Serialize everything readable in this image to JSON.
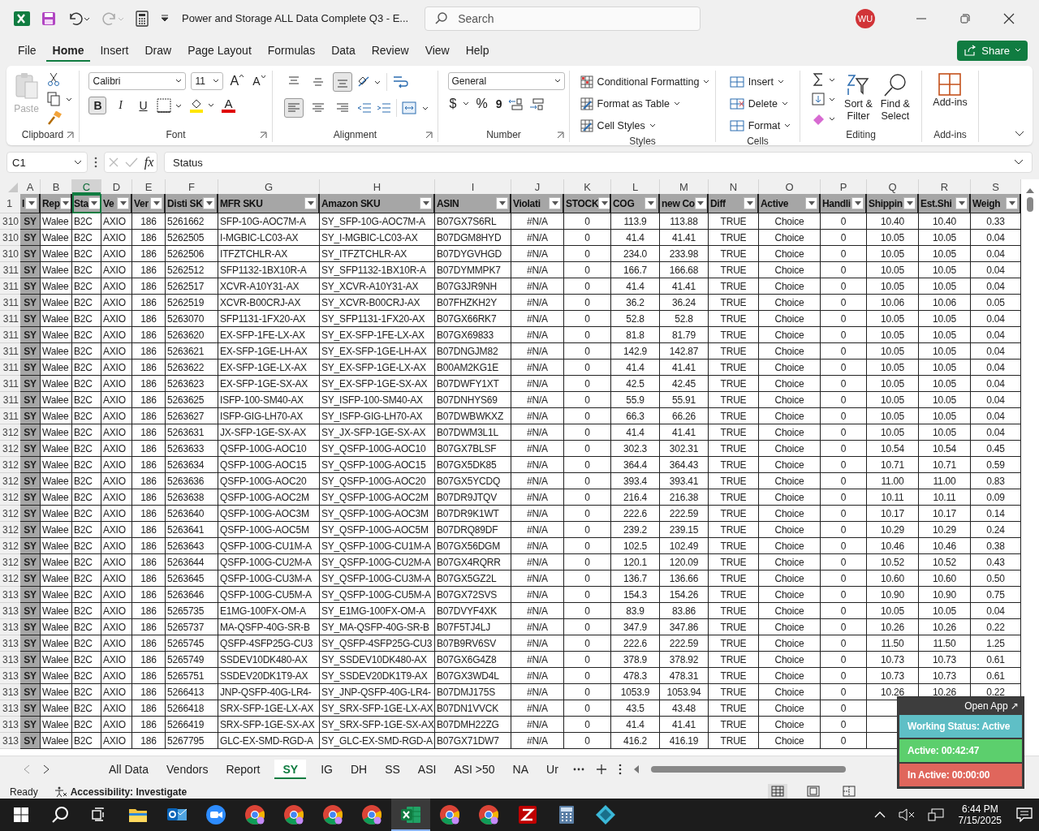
{
  "title_bar": {
    "title": "Power and Storage ALL Data Complete Q3  -  E...",
    "search_placeholder": "Search",
    "avatar": "WU"
  },
  "menu_tabs": [
    {
      "label": "File",
      "selected": false
    },
    {
      "label": "Home",
      "selected": true
    },
    {
      "label": "Insert",
      "selected": false
    },
    {
      "label": "Draw",
      "selected": false
    },
    {
      "label": "Page Layout",
      "selected": false
    },
    {
      "label": "Formulas",
      "selected": false
    },
    {
      "label": "Data",
      "selected": false
    },
    {
      "label": "Review",
      "selected": false
    },
    {
      "label": "View",
      "selected": false
    },
    {
      "label": "Help",
      "selected": false
    }
  ],
  "share": "Share",
  "ribbon": {
    "clipboard": {
      "paste": "Paste",
      "paste_disabled": true,
      "label": "Clipboard"
    },
    "font": {
      "family": "Calibri",
      "size": "11",
      "grow": "A",
      "shrink": "A",
      "bold": "B",
      "bold_on": true,
      "italic": "I",
      "underline": "U",
      "color_glyph": "A",
      "label": "Font"
    },
    "alignment": {
      "vertical": [
        {
          "kind": "top",
          "selected": false
        },
        {
          "kind": "middle",
          "selected": false
        },
        {
          "kind": "bottom",
          "selected": true
        }
      ],
      "horizontal": [
        {
          "kind": "left",
          "selected": true
        },
        {
          "kind": "center",
          "selected": false
        },
        {
          "kind": "right",
          "selected": false
        }
      ],
      "label": "Alignment"
    },
    "number": {
      "format": "General",
      "currency": "$",
      "percent": "%",
      "comma": "9",
      "label": "Number"
    },
    "styles": {
      "items": [
        "Conditional Formatting",
        "Format as Table",
        "Cell Styles"
      ],
      "label": "Styles"
    },
    "cells": {
      "items": [
        "Insert",
        "Delete",
        "Format"
      ],
      "label": "Cells"
    },
    "editing": {
      "sort": [
        "Sort &",
        "Filter"
      ],
      "find": [
        "Find &",
        "Select"
      ],
      "label": "Editing"
    },
    "addins": {
      "button": "Add-ins",
      "label": "Add-ins"
    }
  },
  "formula_bar": {
    "name_box": "C1",
    "fx": "fx",
    "value": "Status"
  },
  "sheet": {
    "header_row": "1",
    "columns": [
      {
        "letter": "A",
        "header": "I",
        "selected": false
      },
      {
        "letter": "B",
        "header": "Rep",
        "selected": false
      },
      {
        "letter": "C",
        "header": "Sta",
        "selected": true
      },
      {
        "letter": "D",
        "header": "Ve",
        "selected": false
      },
      {
        "letter": "E",
        "header": "Ver",
        "selected": false
      },
      {
        "letter": "F",
        "header": "Disti SK",
        "selected": false
      },
      {
        "letter": "G",
        "header": "MFR SKU",
        "selected": false
      },
      {
        "letter": "H",
        "header": "Amazon SKU",
        "selected": false
      },
      {
        "letter": "I",
        "header": "ASIN",
        "selected": false
      },
      {
        "letter": "J",
        "header": "Violati",
        "selected": false
      },
      {
        "letter": "K",
        "header": "STOCK",
        "selected": false
      },
      {
        "letter": "L",
        "header": "COG",
        "selected": false
      },
      {
        "letter": "M",
        "header": "new Co",
        "selected": false
      },
      {
        "letter": "N",
        "header": "Diff",
        "selected": false
      },
      {
        "letter": "O",
        "header": "Active",
        "selected": false
      },
      {
        "letter": "P",
        "header": "Handli",
        "selected": false
      },
      {
        "letter": "Q",
        "header": "Shippin",
        "selected": false
      },
      {
        "letter": "R",
        "header": "Est.Shi",
        "selected": false
      },
      {
        "letter": "S",
        "header": "Weigh",
        "selected": false
      }
    ],
    "rows": [
      {
        "num": "310",
        "cells": [
          "SY",
          "Walee",
          "B2C",
          "AXIO",
          "186",
          "5261662",
          "SFP-10G-AOC7M-A",
          "SY_SFP-10G-AOC7M-A",
          "B07GX7S6RL",
          "#N/A",
          "0",
          "113.9",
          "113.88",
          "TRUE",
          "Choice",
          "0",
          "10.40",
          "10.40",
          "0.33"
        ]
      },
      {
        "num": "310",
        "cells": [
          "SY",
          "Walee",
          "B2C",
          "AXIO",
          "186",
          "5262505",
          "I-MGBIC-LC03-AX",
          "SY_I-MGBIC-LC03-AX",
          "B07DGM8HYD",
          "#N/A",
          "0",
          "41.4",
          "41.41",
          "TRUE",
          "Choice",
          "0",
          "10.05",
          "10.05",
          "0.04"
        ]
      },
      {
        "num": "310",
        "cells": [
          "SY",
          "Walee",
          "B2C",
          "AXIO",
          "186",
          "5262506",
          "ITFZTCHLR-AX",
          "SY_ITFZTCHLR-AX",
          "B07DYGVHGD",
          "#N/A",
          "0",
          "234.0",
          "233.98",
          "TRUE",
          "Choice",
          "0",
          "10.05",
          "10.05",
          "0.04"
        ]
      },
      {
        "num": "311",
        "cells": [
          "SY",
          "Walee",
          "B2C",
          "AXIO",
          "186",
          "5262512",
          "SFP1132-1BX10R-A",
          "SY_SFP1132-1BX10R-A",
          "B07DYMMPK7",
          "#N/A",
          "0",
          "166.7",
          "166.68",
          "TRUE",
          "Choice",
          "0",
          "10.05",
          "10.05",
          "0.04"
        ]
      },
      {
        "num": "311",
        "cells": [
          "SY",
          "Walee",
          "B2C",
          "AXIO",
          "186",
          "5262517",
          "XCVR-A10Y31-AX",
          "SY_XCVR-A10Y31-AX",
          "B07G3JR9NH",
          "#N/A",
          "0",
          "41.4",
          "41.41",
          "TRUE",
          "Choice",
          "0",
          "10.05",
          "10.05",
          "0.04"
        ]
      },
      {
        "num": "311",
        "cells": [
          "SY",
          "Walee",
          "B2C",
          "AXIO",
          "186",
          "5262519",
          "XCVR-B00CRJ-AX",
          "SY_XCVR-B00CRJ-AX",
          "B07FHZKH2Y",
          "#N/A",
          "0",
          "36.2",
          "36.24",
          "TRUE",
          "Choice",
          "0",
          "10.06",
          "10.06",
          "0.05"
        ]
      },
      {
        "num": "311",
        "cells": [
          "SY",
          "Walee",
          "B2C",
          "AXIO",
          "186",
          "5263070",
          "SFP1131-1FX20-AX",
          "SY_SFP1131-1FX20-AX",
          "B07GX66RK7",
          "#N/A",
          "0",
          "52.8",
          "52.8",
          "TRUE",
          "Choice",
          "0",
          "10.05",
          "10.05",
          "0.04"
        ]
      },
      {
        "num": "311",
        "cells": [
          "SY",
          "Walee",
          "B2C",
          "AXIO",
          "186",
          "5263620",
          "EX-SFP-1FE-LX-AX",
          "SY_EX-SFP-1FE-LX-AX",
          "B07GX69833",
          "#N/A",
          "0",
          "81.8",
          "81.79",
          "TRUE",
          "Choice",
          "0",
          "10.05",
          "10.05",
          "0.04"
        ]
      },
      {
        "num": "311",
        "cells": [
          "SY",
          "Walee",
          "B2C",
          "AXIO",
          "186",
          "5263621",
          "EX-SFP-1GE-LH-AX",
          "SY_EX-SFP-1GE-LH-AX",
          "B07DNGJM82",
          "#N/A",
          "0",
          "142.9",
          "142.87",
          "TRUE",
          "Choice",
          "0",
          "10.05",
          "10.05",
          "0.04"
        ]
      },
      {
        "num": "311",
        "cells": [
          "SY",
          "Walee",
          "B2C",
          "AXIO",
          "186",
          "5263622",
          "EX-SFP-1GE-LX-AX",
          "SY_EX-SFP-1GE-LX-AX",
          "B00AM2KG1E",
          "#N/A",
          "0",
          "41.4",
          "41.41",
          "TRUE",
          "Choice",
          "0",
          "10.05",
          "10.05",
          "0.04"
        ]
      },
      {
        "num": "311",
        "cells": [
          "SY",
          "Walee",
          "B2C",
          "AXIO",
          "186",
          "5263623",
          "EX-SFP-1GE-SX-AX",
          "SY_EX-SFP-1GE-SX-AX",
          "B07DWFY1XT",
          "#N/A",
          "0",
          "42.5",
          "42.45",
          "TRUE",
          "Choice",
          "0",
          "10.05",
          "10.05",
          "0.04"
        ]
      },
      {
        "num": "311",
        "cells": [
          "SY",
          "Walee",
          "B2C",
          "AXIO",
          "186",
          "5263625",
          "ISFP-100-SM40-AX",
          "SY_ISFP-100-SM40-AX",
          "B07DNHYS69",
          "#N/A",
          "0",
          "55.9",
          "55.91",
          "TRUE",
          "Choice",
          "0",
          "10.05",
          "10.05",
          "0.04"
        ]
      },
      {
        "num": "311",
        "cells": [
          "SY",
          "Walee",
          "B2C",
          "AXIO",
          "186",
          "5263627",
          "ISFP-GIG-LH70-AX",
          "SY_ISFP-GIG-LH70-AX",
          "B07DWBWKXZ",
          "#N/A",
          "0",
          "66.3",
          "66.26",
          "TRUE",
          "Choice",
          "0",
          "10.05",
          "10.05",
          "0.04"
        ]
      },
      {
        "num": "312",
        "cells": [
          "SY",
          "Walee",
          "B2C",
          "AXIO",
          "186",
          "5263631",
          "JX-SFP-1GE-SX-AX",
          "SY_JX-SFP-1GE-SX-AX",
          "B07DWM3L1L",
          "#N/A",
          "0",
          "41.4",
          "41.41",
          "TRUE",
          "Choice",
          "0",
          "10.05",
          "10.05",
          "0.04"
        ]
      },
      {
        "num": "312",
        "cells": [
          "SY",
          "Walee",
          "B2C",
          "AXIO",
          "186",
          "5263633",
          "QSFP-100G-AOC10",
          "SY_QSFP-100G-AOC10",
          "B07GX7BLSF",
          "#N/A",
          "0",
          "302.3",
          "302.31",
          "TRUE",
          "Choice",
          "0",
          "10.54",
          "10.54",
          "0.45"
        ]
      },
      {
        "num": "312",
        "cells": [
          "SY",
          "Walee",
          "B2C",
          "AXIO",
          "186",
          "5263634",
          "QSFP-100G-AOC15",
          "SY_QSFP-100G-AOC15",
          "B07GX5DK85",
          "#N/A",
          "0",
          "364.4",
          "364.43",
          "TRUE",
          "Choice",
          "0",
          "10.71",
          "10.71",
          "0.59"
        ]
      },
      {
        "num": "312",
        "cells": [
          "SY",
          "Walee",
          "B2C",
          "AXIO",
          "186",
          "5263636",
          "QSFP-100G-AOC20",
          "SY_QSFP-100G-AOC20",
          "B07GX5YCDQ",
          "#N/A",
          "0",
          "393.4",
          "393.41",
          "TRUE",
          "Choice",
          "0",
          "11.00",
          "11.00",
          "0.83"
        ]
      },
      {
        "num": "312",
        "cells": [
          "SY",
          "Walee",
          "B2C",
          "AXIO",
          "186",
          "5263638",
          "QSFP-100G-AOC2M",
          "SY_QSFP-100G-AOC2M",
          "B07DR9JTQV",
          "#N/A",
          "0",
          "216.4",
          "216.38",
          "TRUE",
          "Choice",
          "0",
          "10.11",
          "10.11",
          "0.09"
        ]
      },
      {
        "num": "312",
        "cells": [
          "SY",
          "Walee",
          "B2C",
          "AXIO",
          "186",
          "5263640",
          "QSFP-100G-AOC3M",
          "SY_QSFP-100G-AOC3M",
          "B07DR9K1WT",
          "#N/A",
          "0",
          "222.6",
          "222.59",
          "TRUE",
          "Choice",
          "0",
          "10.17",
          "10.17",
          "0.14"
        ]
      },
      {
        "num": "312",
        "cells": [
          "SY",
          "Walee",
          "B2C",
          "AXIO",
          "186",
          "5263641",
          "QSFP-100G-AOC5M",
          "SY_QSFP-100G-AOC5M",
          "B07DRQ89DF",
          "#N/A",
          "0",
          "239.2",
          "239.15",
          "TRUE",
          "Choice",
          "0",
          "10.29",
          "10.29",
          "0.24"
        ]
      },
      {
        "num": "312",
        "cells": [
          "SY",
          "Walee",
          "B2C",
          "AXIO",
          "186",
          "5263643",
          "QSFP-100G-CU1M-A",
          "SY_QSFP-100G-CU1M-A",
          "B07GX56DGM",
          "#N/A",
          "0",
          "102.5",
          "102.49",
          "TRUE",
          "Choice",
          "0",
          "10.46",
          "10.46",
          "0.38"
        ]
      },
      {
        "num": "312",
        "cells": [
          "SY",
          "Walee",
          "B2C",
          "AXIO",
          "186",
          "5263644",
          "QSFP-100G-CU2M-A",
          "SY_QSFP-100G-CU2M-A",
          "B07GX4RQRR",
          "#N/A",
          "0",
          "120.1",
          "120.09",
          "TRUE",
          "Choice",
          "0",
          "10.52",
          "10.52",
          "0.43"
        ]
      },
      {
        "num": "312",
        "cells": [
          "SY",
          "Walee",
          "B2C",
          "AXIO",
          "186",
          "5263645",
          "QSFP-100G-CU3M-A",
          "SY_QSFP-100G-CU3M-A",
          "B07GX5GZ2L",
          "#N/A",
          "0",
          "136.7",
          "136.66",
          "TRUE",
          "Choice",
          "0",
          "10.60",
          "10.60",
          "0.50"
        ]
      },
      {
        "num": "313",
        "cells": [
          "SY",
          "Walee",
          "B2C",
          "AXIO",
          "186",
          "5263646",
          "QSFP-100G-CU5M-A",
          "SY_QSFP-100G-CU5M-A",
          "B07GX72SVS",
          "#N/A",
          "0",
          "154.3",
          "154.26",
          "TRUE",
          "Choice",
          "0",
          "10.90",
          "10.90",
          "0.75"
        ]
      },
      {
        "num": "313",
        "cells": [
          "SY",
          "Walee",
          "B2C",
          "AXIO",
          "186",
          "5265735",
          "E1MG-100FX-OM-A",
          "SY_E1MG-100FX-OM-A",
          "B07DVYF4XK",
          "#N/A",
          "0",
          "83.9",
          "83.86",
          "TRUE",
          "Choice",
          "0",
          "10.05",
          "10.05",
          "0.04"
        ]
      },
      {
        "num": "313",
        "cells": [
          "SY",
          "Walee",
          "B2C",
          "AXIO",
          "186",
          "5265737",
          "MA-QSFP-40G-SR-B",
          "SY_MA-QSFP-40G-SR-B",
          "B07F5TJ4LJ",
          "#N/A",
          "0",
          "347.9",
          "347.86",
          "TRUE",
          "Choice",
          "0",
          "10.26",
          "10.26",
          "0.22"
        ]
      },
      {
        "num": "313",
        "cells": [
          "SY",
          "Walee",
          "B2C",
          "AXIO",
          "186",
          "5265745",
          "QSFP-4SFP25G-CU3",
          "SY_QSFP-4SFP25G-CU3",
          "B07B9RV6SV",
          "#N/A",
          "0",
          "222.6",
          "222.59",
          "TRUE",
          "Choice",
          "0",
          "11.50",
          "11.50",
          "1.25"
        ]
      },
      {
        "num": "313",
        "cells": [
          "SY",
          "Walee",
          "B2C",
          "AXIO",
          "186",
          "5265749",
          "SSDEV10DK480-AX",
          "SY_SSDEV10DK480-AX",
          "B07GX6G4Z8",
          "#N/A",
          "0",
          "378.9",
          "378.92",
          "TRUE",
          "Choice",
          "0",
          "10.73",
          "10.73",
          "0.61"
        ]
      },
      {
        "num": "313",
        "cells": [
          "SY",
          "Walee",
          "B2C",
          "AXIO",
          "186",
          "5265751",
          "SSDEV20DK1T9-AX",
          "SY_SSDEV20DK1T9-AX",
          "B07GX3WD4L",
          "#N/A",
          "0",
          "478.3",
          "478.31",
          "TRUE",
          "Choice",
          "0",
          "10.73",
          "10.73",
          "0.61"
        ]
      },
      {
        "num": "313",
        "cells": [
          "SY",
          "Walee",
          "B2C",
          "AXIO",
          "186",
          "5266413",
          "JNP-QSFP-40G-LR4-",
          "SY_JNP-QSFP-40G-LR4-",
          "B07DMJ175S",
          "#N/A",
          "0",
          "1053.9",
          "1053.94",
          "TRUE",
          "Choice",
          "0",
          "10.26",
          "10.26",
          "0.22"
        ]
      },
      {
        "num": "313",
        "cells": [
          "SY",
          "Walee",
          "B2C",
          "AXIO",
          "186",
          "5266418",
          "SRX-SFP-1GE-LX-AX",
          "SY_SRX-SFP-1GE-LX-AX",
          "B07DN1VVCK",
          "#N/A",
          "0",
          "43.5",
          "43.48",
          "TRUE",
          "Choice",
          "0",
          null,
          null,
          null
        ]
      },
      {
        "num": "313",
        "cells": [
          "SY",
          "Walee",
          "B2C",
          "AXIO",
          "186",
          "5266419",
          "SRX-SFP-1GE-SX-AX",
          "SY_SRX-SFP-1GE-SX-AX",
          "B07DMH22ZG",
          "#N/A",
          "0",
          "41.4",
          "41.41",
          "TRUE",
          "Choice",
          "0",
          null,
          null,
          null
        ]
      },
      {
        "num": "313",
        "cells": [
          "SY",
          "Walee",
          "B2C",
          "AXIO",
          "186",
          "5267795",
          "GLC-EX-SMD-RGD-A",
          "SY_GLC-EX-SMD-RGD-A",
          "B07GX71DW7",
          "#N/A",
          "0",
          "416.2",
          "416.19",
          "TRUE",
          "Choice",
          "0",
          null,
          null,
          null
        ]
      }
    ]
  },
  "sheet_tabs": [
    {
      "label": "All Data",
      "selected": false
    },
    {
      "label": "Vendors",
      "selected": false
    },
    {
      "label": "Report",
      "selected": false
    },
    {
      "label": "SY",
      "selected": true
    },
    {
      "label": "IG",
      "selected": false
    },
    {
      "label": "DH",
      "selected": false
    },
    {
      "label": "SS",
      "selected": false
    },
    {
      "label": "ASI",
      "selected": false
    },
    {
      "label": "ASI >50",
      "selected": false
    },
    {
      "label": "NA",
      "selected": false
    },
    {
      "label": "Ur",
      "selected": false
    }
  ],
  "status_bar": {
    "mode": "Ready",
    "accessibility": "Accessibility: Investigate",
    "views": [
      {
        "kind": "normal",
        "selected": true
      },
      {
        "kind": "page-layout",
        "selected": false
      },
      {
        "kind": "page-break",
        "selected": false
      }
    ]
  },
  "tracker": {
    "open_app": "Open App ↗",
    "status": "Working Status: Active",
    "active": "Active: 00:42:47",
    "inactive": "In Active: 00:00:00"
  },
  "taskbar": {
    "apps": [
      {
        "kind": "start",
        "selected": false
      },
      {
        "kind": "search",
        "selected": false
      },
      {
        "kind": "taskview",
        "selected": false
      },
      {
        "kind": "explorer",
        "selected": false
      },
      {
        "kind": "outlook",
        "selected": false
      },
      {
        "kind": "zoom",
        "selected": false
      },
      {
        "kind": "chrome",
        "selected": false
      },
      {
        "kind": "chrome",
        "selected": false
      },
      {
        "kind": "chrome",
        "selected": false
      },
      {
        "kind": "chrome",
        "selected": false
      },
      {
        "kind": "excel",
        "selected": true
      },
      {
        "kind": "chrome",
        "selected": false
      },
      {
        "kind": "chrome",
        "selected": false
      },
      {
        "kind": "filezilla",
        "selected": false
      },
      {
        "kind": "calculator",
        "selected": false
      },
      {
        "kind": "diamond",
        "selected": false
      }
    ],
    "time": "6:44 PM",
    "date": "7/15/2025"
  }
}
